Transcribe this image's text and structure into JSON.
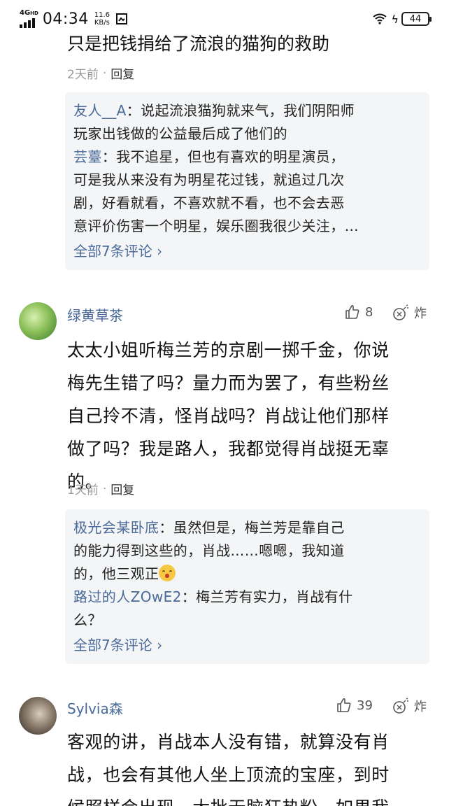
{
  "status_bar": {
    "network": "4G",
    "network_sup": "HD",
    "time": "04:34",
    "speed_value": "11.6",
    "speed_unit": "KB/s",
    "battery": "44"
  },
  "top_fragment": {
    "text": "只是把钱捐给了流浪的猫狗的救助",
    "time": "2天前",
    "reply": "回复"
  },
  "reply_box_1": {
    "lines": [
      {
        "name": "友人__A",
        "text": "：说起流浪猫狗就来气，我们阴阳师"
      },
      {
        "name": "",
        "text": "玩家出钱做的公益最后成了他们的"
      },
      {
        "name": "芸薹",
        "text": "：我不追星，但也有喜欢的明星演员，"
      },
      {
        "name": "",
        "text": "可是我从来没有为明星花过钱，就追过几次"
      },
      {
        "name": "",
        "text": "剧，好看就看，不喜欢就不看，也不会去恶"
      },
      {
        "name": "",
        "text": "意评价伤害一个明星，娱乐圈我很少关注，…"
      }
    ],
    "more": "全部7条评论 ›"
  },
  "comment_1": {
    "user": "绿黄草茶",
    "likes": "8",
    "bomb": "炸",
    "lines": [
      "太太小姐听梅兰芳的京剧一掷千金，你说",
      "梅先生错了吗？量力而为罢了，有些粉丝",
      "自己拎不清，怪肖战吗？肖战让他们那样",
      "做了吗？我是路人，我都觉得肖战挺无辜",
      "的。"
    ],
    "time": "1天前",
    "reply": "回复"
  },
  "reply_box_2": {
    "lines": [
      {
        "name": "极光会某卧底",
        "text": "：虽然但是，梅兰芳是靠自己"
      },
      {
        "name": "",
        "text": "的能力得到这些的，肖战……嗯嗯，我知道"
      },
      {
        "name": "",
        "text": "的，他三观正"
      },
      {
        "name": "路过的人ZOwE2",
        "text": "：梅兰芳有实力，肖战有什"
      },
      {
        "name": "",
        "text": "么？"
      }
    ],
    "more": "全部7条评论 ›"
  },
  "comment_2": {
    "user": "Sylvia森",
    "likes": "39",
    "bomb": "炸",
    "lines": [
      "客观的讲，肖战本人没有错，就算没有肖",
      "战，也会有其他人坐上顶流的宝座，到时",
      "候照样会出现一大批无脑狂热粉。如果我"
    ]
  }
}
